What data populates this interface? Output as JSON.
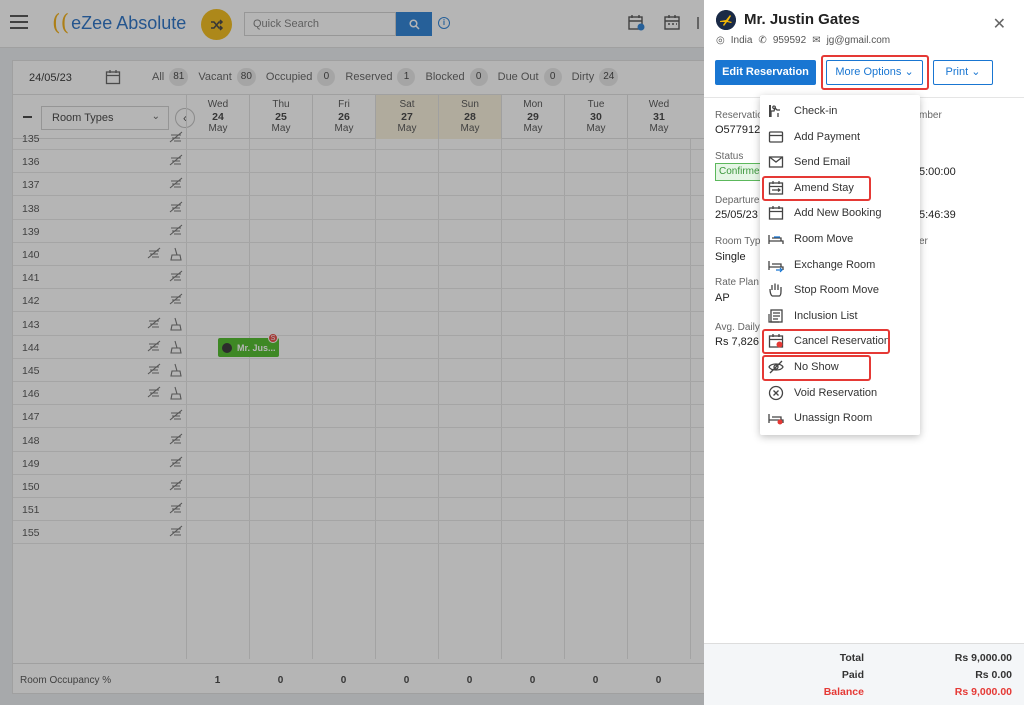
{
  "app": {
    "logo_text": "eZee Absolute"
  },
  "search": {
    "placeholder": "Quick Search"
  },
  "filterbar": {
    "date": "24/05/23",
    "filters": [
      {
        "label": "All",
        "count": "81"
      },
      {
        "label": "Vacant",
        "count": "80"
      },
      {
        "label": "Occupied",
        "count": "0"
      },
      {
        "label": "Reserved",
        "count": "1"
      },
      {
        "label": "Blocked",
        "count": "0"
      },
      {
        "label": "Due Out",
        "count": "0"
      },
      {
        "label": "Dirty",
        "count": "24"
      }
    ]
  },
  "grid": {
    "room_types_label": "Room Types",
    "days": [
      {
        "dow": "Wed",
        "day": "24",
        "month": "May",
        "weekend": false
      },
      {
        "dow": "Thu",
        "day": "25",
        "month": "May",
        "weekend": false
      },
      {
        "dow": "Fri",
        "day": "26",
        "month": "May",
        "weekend": false
      },
      {
        "dow": "Sat",
        "day": "27",
        "month": "May",
        "weekend": true
      },
      {
        "dow": "Sun",
        "day": "28",
        "month": "May",
        "weekend": true
      },
      {
        "dow": "Mon",
        "day": "29",
        "month": "May",
        "weekend": false
      },
      {
        "dow": "Tue",
        "day": "30",
        "month": "May",
        "weekend": false
      },
      {
        "dow": "Wed",
        "day": "31",
        "month": "May",
        "weekend": false
      }
    ],
    "rooms": [
      {
        "number": "135",
        "extra_icon": false
      },
      {
        "number": "136",
        "extra_icon": false
      },
      {
        "number": "137",
        "extra_icon": false
      },
      {
        "number": "138",
        "extra_icon": false
      },
      {
        "number": "139",
        "extra_icon": false
      },
      {
        "number": "140",
        "extra_icon": true
      },
      {
        "number": "141",
        "extra_icon": false
      },
      {
        "number": "142",
        "extra_icon": false
      },
      {
        "number": "143",
        "extra_icon": true
      },
      {
        "number": "144",
        "extra_icon": true
      },
      {
        "number": "145",
        "extra_icon": true
      },
      {
        "number": "146",
        "extra_icon": true
      },
      {
        "number": "147",
        "extra_icon": false
      },
      {
        "number": "148",
        "extra_icon": false
      },
      {
        "number": "149",
        "extra_icon": false
      },
      {
        "number": "150",
        "extra_icon": false
      },
      {
        "number": "151",
        "extra_icon": false
      },
      {
        "number": "155",
        "extra_icon": false
      }
    ],
    "booking": {
      "label": "Mr. Jus...",
      "badge": "S"
    },
    "occupancy": {
      "label": "Room Occupancy %",
      "values": [
        "1",
        "0",
        "0",
        "0",
        "0",
        "0",
        "0",
        "0"
      ]
    }
  },
  "panel": {
    "guest_name": "Mr. Justin Gates",
    "country": "India",
    "phone": "959592",
    "email": "jg@gmail.com",
    "edit_label": "Edit Reservation",
    "more_label": "More Options",
    "print_label": "Print",
    "info": {
      "reservation_lbl": "Reservation",
      "reservation_val": "O577912F",
      "number_lbl": "mber",
      "status_lbl": "Status",
      "status_val": "Confirmed",
      "arrival_time": "5:00:00",
      "departure_lbl": "Departure",
      "departure_val": "25/05/23",
      "departure_time": "5:46:39",
      "roomtype_lbl": "Room Type",
      "roomtype_val": "Single",
      "roomtype_side": "er",
      "rateplan_lbl": "Rate Plan",
      "rateplan_val": "AP",
      "avgdaily_lbl": "Avg. Daily",
      "avgdaily_val": "Rs 7,826.("
    },
    "totals": {
      "total_lbl": "Total",
      "total_val": "Rs 9,000.00",
      "paid_lbl": "Paid",
      "paid_val": "Rs 0.00",
      "balance_lbl": "Balance",
      "balance_val": "Rs 9,000.00"
    }
  },
  "menu": {
    "items": [
      {
        "label": "Check-in",
        "icon": "check-in-icon"
      },
      {
        "label": "Add Payment",
        "icon": "payment-card-icon"
      },
      {
        "label": "Send Email",
        "icon": "envelope-icon"
      },
      {
        "label": "Amend Stay",
        "icon": "calendar-arrows-icon"
      },
      {
        "label": "Add New Booking",
        "icon": "calendar-icon"
      },
      {
        "label": "Room Move",
        "icon": "bed-move-icon"
      },
      {
        "label": "Exchange Room",
        "icon": "bed-exchange-icon"
      },
      {
        "label": "Stop Room Move",
        "icon": "hand-stop-icon"
      },
      {
        "label": "Inclusion List",
        "icon": "inclusion-list-icon"
      },
      {
        "label": "Cancel Reservation",
        "icon": "calendar-cancel-icon"
      },
      {
        "label": "No Show",
        "icon": "eye-off-icon"
      },
      {
        "label": "Void Reservation",
        "icon": "circle-x-icon"
      },
      {
        "label": "Unassign Room",
        "icon": "bed-unassign-icon"
      }
    ]
  },
  "colors": {
    "accent": "#1976d2",
    "highlight": "#e53935",
    "booking": "#3fb618"
  }
}
